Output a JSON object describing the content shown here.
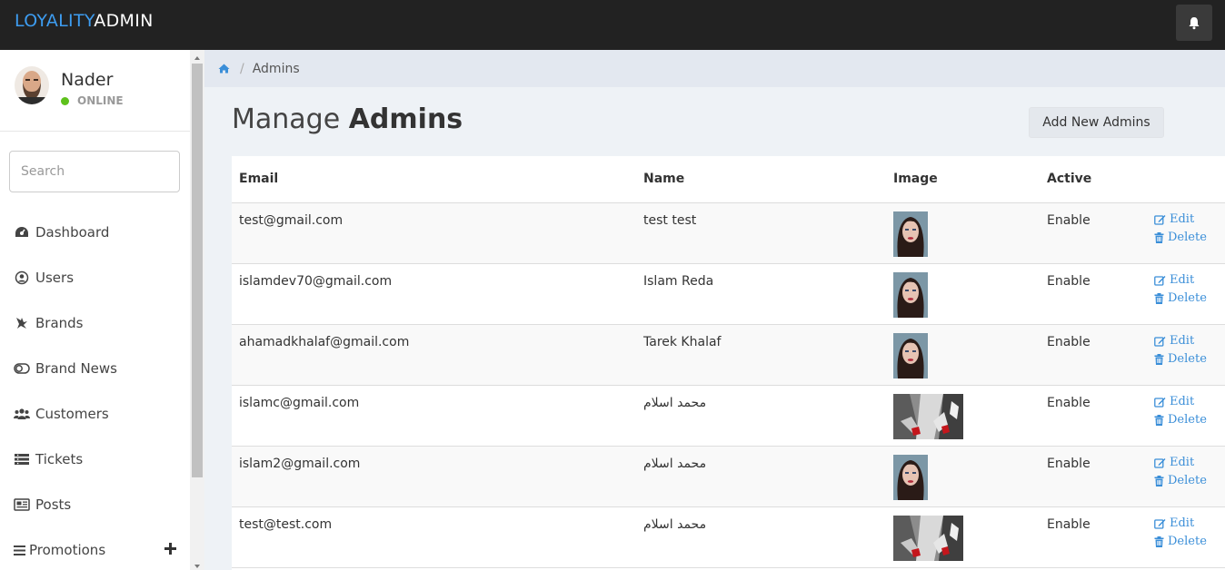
{
  "app": {
    "brand_part1": "LOYALITY",
    "brand_part2": "ADMIN",
    "accent_color": "#3d9cf0",
    "notification_icon": "bell-icon"
  },
  "user": {
    "name": "Nader",
    "status": "ONLINE",
    "status_color": "#5ec11c"
  },
  "sidebar": {
    "search_placeholder": "Search",
    "items": [
      {
        "label": "Dashboard",
        "icon": "dashboard-icon"
      },
      {
        "label": "Users",
        "icon": "user-circle-icon"
      },
      {
        "label": "Brands",
        "icon": "brand-icon"
      },
      {
        "label": "Brand News",
        "icon": "toggle-icon"
      },
      {
        "label": "Customers",
        "icon": "users-group-icon"
      },
      {
        "label": "Tickets",
        "icon": "list-icon"
      },
      {
        "label": "Posts",
        "icon": "newspaper-icon"
      },
      {
        "label": "Promotions",
        "icon": "bars-icon",
        "expand_icon": "plus-icon"
      }
    ]
  },
  "breadcrumb": {
    "home_icon": "home-icon",
    "current": "Admins"
  },
  "page": {
    "title_light": "Manage",
    "title_bold": "Admins",
    "add_button": "Add New Admins"
  },
  "table": {
    "headers": [
      "Email",
      "Name",
      "Image",
      "Active",
      ""
    ],
    "edit_label": "Edit",
    "delete_label": "Delete",
    "rows": [
      {
        "email": "test@gmail.com",
        "name": "test test",
        "image": "portrait",
        "active": "Enable"
      },
      {
        "email": "islamdev70@gmail.com",
        "name": "Islam Reda",
        "image": "portrait",
        "active": "Enable"
      },
      {
        "email": "ahamadkhalaf@gmail.com",
        "name": "Tarek Khalaf",
        "image": "portrait",
        "active": "Enable"
      },
      {
        "email": "islamc@gmail.com",
        "name": "محمد اسلام",
        "image": "shoes",
        "active": "Enable"
      },
      {
        "email": "islam2@gmail.com",
        "name": "محمد اسلام",
        "image": "portrait",
        "active": "Enable"
      },
      {
        "email": "test@test.com",
        "name": "محمد اسلام",
        "image": "shoes",
        "active": "Enable"
      }
    ]
  }
}
